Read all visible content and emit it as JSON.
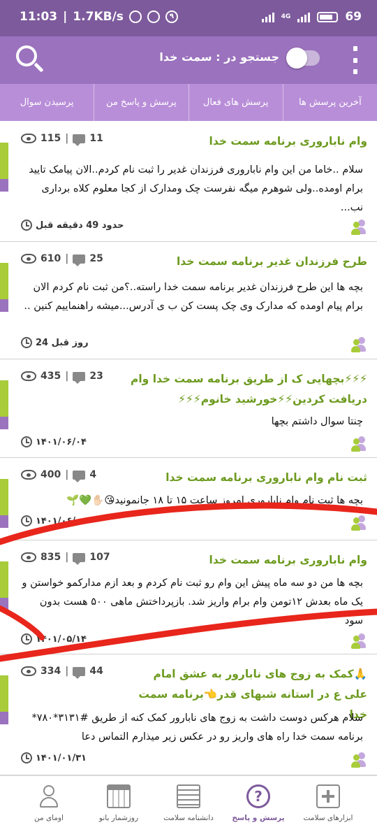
{
  "status_bar": {
    "time": "11:03",
    "net_speed": "1.7KB/s",
    "notification_count": "۹",
    "network": "4G",
    "battery": "69"
  },
  "header": {
    "search_label": "جستجو در : سمت خدا",
    "toggle_on": false,
    "search_icon": "search-icon",
    "menu_icon": "more-vertical-icon"
  },
  "tabs": [
    "آخرین پرسش ها",
    "پرسش های فعال",
    "پرسش و پاسخ من",
    "پرسیدن سوال"
  ],
  "posts": [
    {
      "title": "وام ناباروری برنامه سمت خدا",
      "comments": "11",
      "views": "115",
      "body": "سلام ..خاما من این وام ناباروری فرزندان غدیر را ثبت نام کردم..الان پیامک تایید برام اومده..ولی شوهرم میگه نفرست چک ومدارک از کجا معلوم کلاه برداری نب...",
      "time": "حدود 49 دقیقه قبل"
    },
    {
      "title": "طرح فرزندان غدیر برنامه سمت خدا",
      "comments": "25",
      "views": "610",
      "body": "بچه ها این طرح فرزندان غدیر برنامه سمت خدا راسته..؟من ثبت نام کردم الان برام پیام اومده که مدارک وی چک پست کن ب ی آدرس...میشه راهنماییم کنین ..",
      "time": "24 روز قبل"
    },
    {
      "title": "⚡⚡⚡بچهایی ک از طریق برنامه سمت خدا وام دریافت کردین⚡⚡خورشید خانوم⚡⚡⚡",
      "comments": "23",
      "views": "435",
      "body": "چنتا سوال داشتم بچها",
      "time": "۱۴۰۱/۰۶/۰۴"
    },
    {
      "title": "ثبت نام وام ناباروری برنامه سمت خدا",
      "comments": "4",
      "views": "400",
      "body": "بچه ها ثبت نام وام ناباروری امروز ساعت ۱۵ تا ۱۸ جانمونید😘✋🏻💚🌱",
      "time": "۱۴۰۱/۰۶/۰۰"
    },
    {
      "title": "وام ناباروری برنامه سمت خدا",
      "comments": "107",
      "views": "835",
      "body": "بچه ها من دو سه ماه پیش این وام رو ثبت نام کردم و بعد ازم مدارکمو خواستن و یک ماه بعدش ۱۲تومن وام برام واریز شد.  بازپرداختش ماهی ۵۰۰ هست بدون سود",
      "time": "۱۴۰۱/۰۵/۱۴"
    },
    {
      "title": "🙏کمک به زوج های نابارور به عشق امام علی ع در استانه شبهای قدر👈برنامه سمت خدا",
      "comments": "44",
      "views": "334",
      "body": "سلام هرکس دوست داشت به زوج های نابارور کمک کنه از طریق #۳۱۳۱*۷۸۰* برنامه سمت خدا راه های واریز رو در عکس زیر میذارم التماس دعا",
      "time": "۱۴۰۱/۰۱/۳۱"
    }
  ],
  "bottom_nav": [
    {
      "label": "ابزارهای سلامت",
      "icon": "health-kit-icon",
      "active": false
    },
    {
      "label": "پرسش و پاسخ",
      "icon": "question-icon",
      "active": true
    },
    {
      "label": "دانشنامه سلامت",
      "icon": "encyclopedia-icon",
      "active": false
    },
    {
      "label": "روزشمار بانو",
      "icon": "calendar-icon",
      "active": false
    },
    {
      "label": "اومای من",
      "icon": "profile-icon",
      "active": false
    }
  ],
  "colors": {
    "status_bar": "#7d5a9c",
    "header": "#9b72be",
    "tabs": "#b98ed8",
    "title_green": "#6c9a1e",
    "accent_green": "#a8cc3a",
    "annotation_red": "#e8261c"
  }
}
